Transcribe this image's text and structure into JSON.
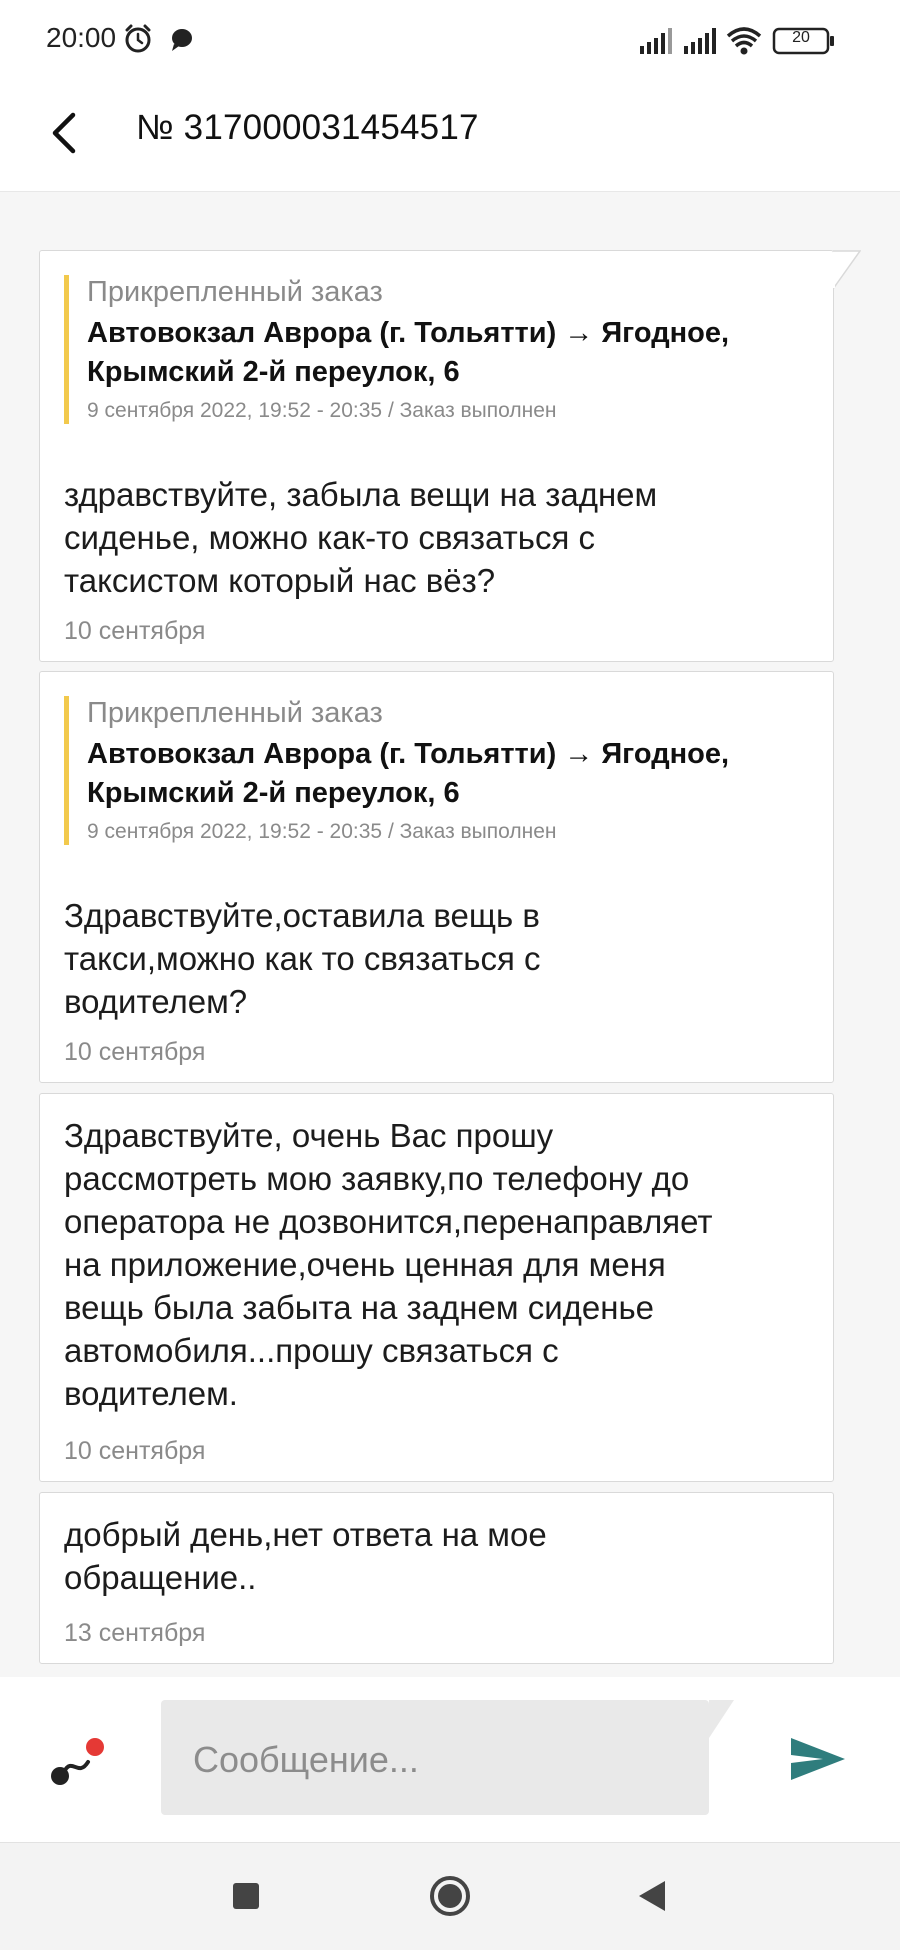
{
  "status_bar": {
    "time": "20:00",
    "battery": "20",
    "left_icons": [
      "alarm-icon",
      "chat-bubble-icon"
    ],
    "right_icons": [
      "signal-icon",
      "signal-icon",
      "wifi-icon",
      "battery-icon"
    ]
  },
  "header": {
    "title": "№ 317000031454517"
  },
  "messages": [
    {
      "attached_label": "Прикрепленный заказ",
      "route": "Автовокзал Аврора (г. Тольятти) → Ягодное, Крымский 2-й переулок, 6",
      "meta": "9 сентября 2022, 19:52 - 20:35 / Заказ выполнен",
      "text": "здравствуйте, забыла вещи на заднем\nсиденье, можно как-то связаться с\nтаксистом который нас вёз?",
      "date": "10 сентября"
    },
    {
      "attached_label": "Прикрепленный заказ",
      "route": "Автовокзал Аврора (г. Тольятти) → Ягодное, Крымский 2-й переулок, 6",
      "meta": "9 сентября 2022, 19:52 - 20:35 / Заказ выполнен",
      "text": "Здравствуйте,оставила вещь в\nтакси,можно как то связаться с\nводителем?",
      "date": "10 сентября"
    },
    {
      "text": "Здравствуйте, очень Вас прошу\nрассмотреть мою заявку,по телефону до\nоператора не дозвонится,перенаправляет\nна приложение,очень ценная для меня\nвещь была забыта на заднем сиденье\nавтомобиля...прошу связаться с\nводителем.",
      "date": "10 сентября"
    },
    {
      "text": "добрый день,нет ответа на мое\nобращение..",
      "date": "13 сентября"
    }
  ],
  "composer": {
    "placeholder": "Сообщение...",
    "value": ""
  },
  "colors": {
    "attached_accent": "#f2c94c",
    "send_icon": "#2f7d7d",
    "attach_dot": "#e53935"
  },
  "nav": {
    "icons": [
      "recent-apps-icon",
      "home-icon",
      "back-icon"
    ]
  }
}
